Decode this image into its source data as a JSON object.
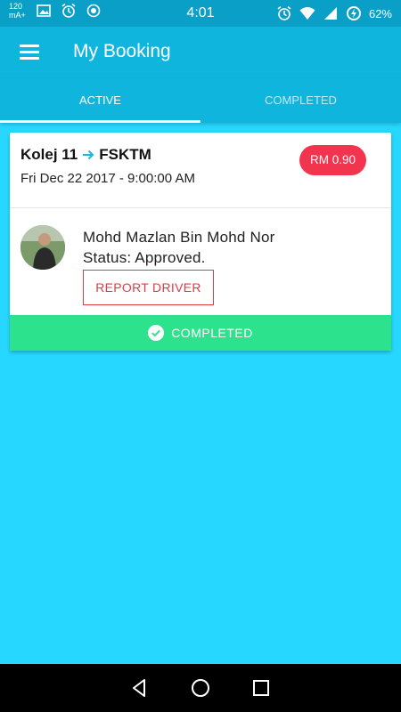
{
  "status_bar": {
    "left_text": "120 mA+",
    "time": "4:01",
    "battery": "62%",
    "icons": [
      "image-icon",
      "alarm-icon",
      "record-icon",
      "alarm-icon",
      "wifi-icon",
      "signal-icon",
      "battery-charging-icon"
    ]
  },
  "app_bar": {
    "title": "My Booking",
    "menu_icon": "hamburger-menu-icon"
  },
  "tabs": [
    {
      "label": "ACTIVE",
      "active": true
    },
    {
      "label": "COMPLETED",
      "active": false
    }
  ],
  "booking": {
    "origin": "Kolej 11",
    "destination": "FSKTM",
    "arrow_icon": "arrow-right-icon",
    "datetime": "Fri Dec 22 2017 - 9:00:00 AM",
    "price": "RM 0.90",
    "driver_name": "Mohd Mazlan Bin Mohd Nor",
    "status": "Status: Approved.",
    "report_button": "REPORT DRIVER",
    "footer_label": "COMPLETED",
    "footer_icon": "check-circle-icon"
  },
  "nav_bar": {
    "buttons": [
      "back-icon",
      "home-icon",
      "recents-icon"
    ]
  },
  "colors": {
    "status_bar": "#0a9fc6",
    "app_bar": "#10b5de",
    "background": "#26d8ff",
    "price_badge": "#f2344f",
    "report_border": "#e53945",
    "completed_footer": "#2de28d"
  }
}
